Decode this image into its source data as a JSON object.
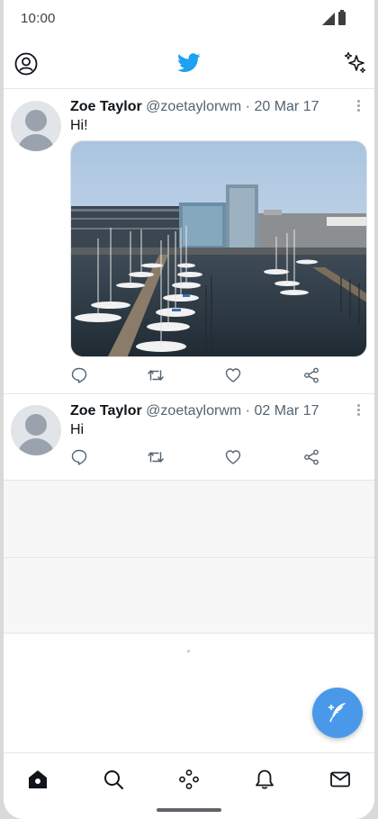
{
  "status_bar": {
    "time": "10:00"
  },
  "colors": {
    "accent": "#1DA1F2",
    "fab": "#4A99E9",
    "text": "#0F1419",
    "muted": "#536471"
  },
  "app_bar": {
    "left_icon": "profile-icon",
    "center_icon": "twitter-bird-icon",
    "right_icon": "sparkle-icon"
  },
  "tweets": [
    {
      "name": "Zoe Taylor",
      "handle": "@zoetaylorwm",
      "separator": "·",
      "date": "20 Mar 17",
      "text": "Hi!",
      "has_media": true,
      "media_description_icon": "photo"
    },
    {
      "name": "Zoe Taylor",
      "handle": "@zoetaylorwm",
      "separator": "·",
      "date": "02 Mar 17",
      "text": "Hi",
      "has_media": false
    }
  ],
  "tweet_actions": [
    "reply-icon",
    "retweet-icon",
    "like-icon",
    "share-icon"
  ],
  "fab": {
    "icon": "compose-tweet-icon"
  },
  "bottom_nav": [
    "home-icon",
    "search-icon",
    "spaces-icon",
    "notifications-icon",
    "messages-icon"
  ]
}
